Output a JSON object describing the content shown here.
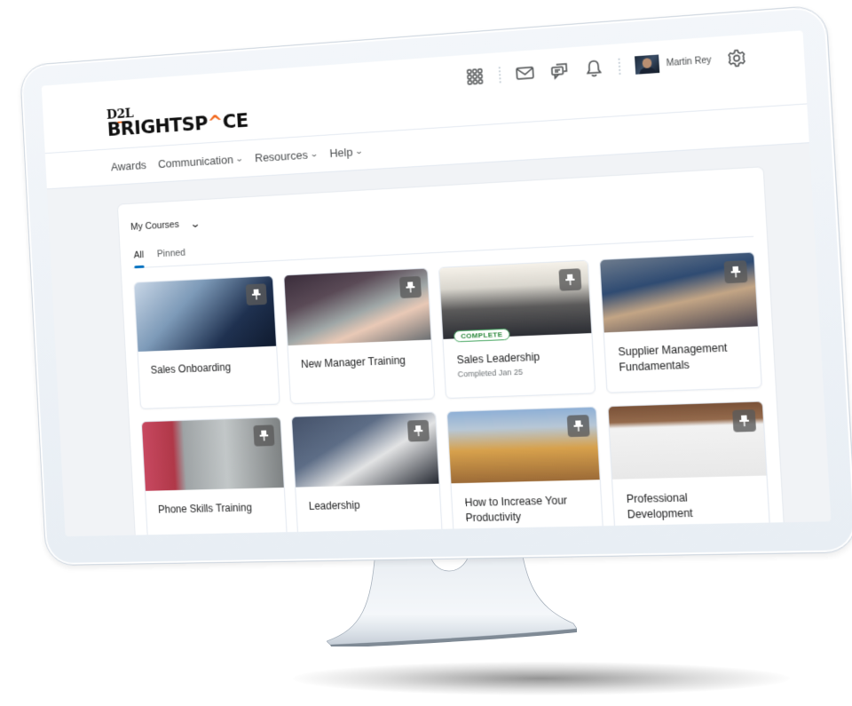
{
  "app": {
    "brand_top": "D2L",
    "brand_main_prefix": "BRIGHTSP",
    "brand_main_caret": "^",
    "brand_main_suffix": "CE",
    "accent_color": "#f26b21",
    "link_color": "#006fbf"
  },
  "header": {
    "icons": [
      "grid-icon",
      "mail-icon",
      "chat-icon",
      "bell-icon",
      "gear-icon"
    ],
    "user_name": "Martin Rey"
  },
  "nav": {
    "items": [
      {
        "label": "Awards",
        "dropdown": false
      },
      {
        "label": "Communication",
        "dropdown": true
      },
      {
        "label": "Resources",
        "dropdown": true
      },
      {
        "label": "Help",
        "dropdown": true
      }
    ]
  },
  "widget": {
    "title": "My Courses",
    "tabs": [
      {
        "label": "All",
        "active": true
      },
      {
        "label": "Pinned",
        "active": false
      }
    ]
  },
  "courses": [
    {
      "title": "Sales Onboarding",
      "pinned": true
    },
    {
      "title": "New Manager Training",
      "pinned": true
    },
    {
      "title": "Sales Leadership",
      "pinned": true,
      "badge": "COMPLETE",
      "subtitle": "Completed Jan 25",
      "badge_color": "#2d8a3e"
    },
    {
      "title": "Supplier Management Fundamentals",
      "pinned": true
    },
    {
      "title": "Phone Skills Training",
      "pinned": true
    },
    {
      "title": "Leadership",
      "pinned": true
    },
    {
      "title": "How to Increase Your Productivity",
      "pinned": true
    },
    {
      "title": "Professional Development",
      "pinned": true
    }
  ]
}
